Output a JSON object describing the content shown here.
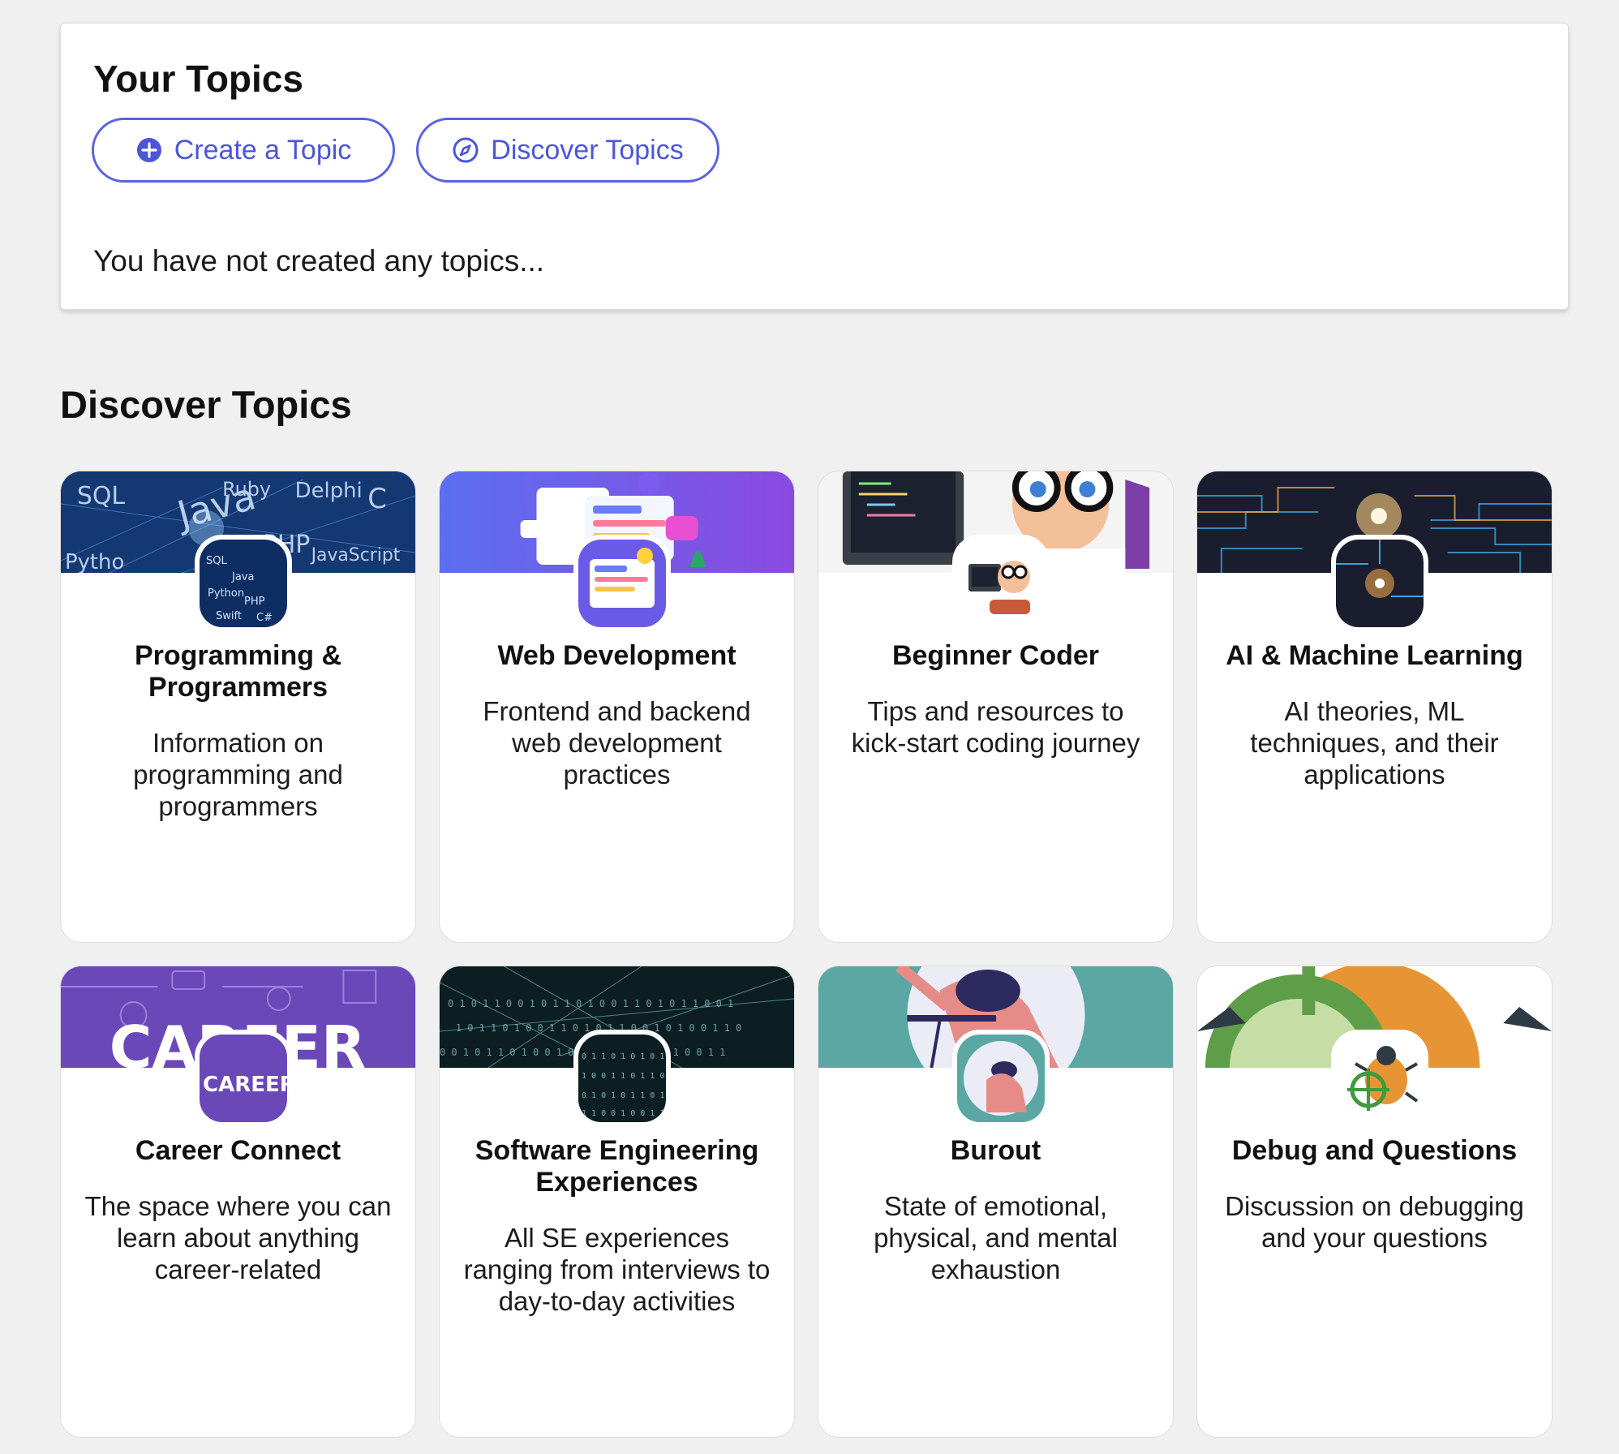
{
  "your_topics": {
    "title": "Your Topics",
    "create_label": "Create a Topic",
    "discover_label": "Discover Topics",
    "empty_message": "You have not created any topics..."
  },
  "discover": {
    "title": "Discover Topics",
    "topics": [
      {
        "title": "Programming & Programmers",
        "description": "Information on programming and programmers",
        "banner_color": "#0d2a5c",
        "image": "code-languages-image"
      },
      {
        "title": "Web Development",
        "description": "Frontend and backend web development practices",
        "banner_color": "#6a5ae6",
        "image": "web-ui-illustration"
      },
      {
        "title": "Beginner Coder",
        "description": "Tips and resources to kick-start coding journey",
        "banner_color": "#f4f4f4",
        "image": "baby-coder-illustration"
      },
      {
        "title": "AI & Machine Learning",
        "description": "AI theories, ML techniques, and their applications",
        "banner_color": "#1a1d2e",
        "image": "circuit-board-image"
      },
      {
        "title": "Career Connect",
        "description": "The space where you can learn about anything career-related",
        "banner_color": "#6a48b8",
        "image": "career-illustration"
      },
      {
        "title": "Software Engineering Experiences",
        "description": "All SE experiences ranging from interviews to day-to-day activities",
        "banner_color": "#0c1e22",
        "image": "data-network-image"
      },
      {
        "title": "Burout",
        "description": "State of emotional, physical, and mental exhaustion",
        "banner_color": "#5aa7a3",
        "image": "burnout-illustration"
      },
      {
        "title": "Debug and Questions",
        "description": "Discussion on debugging and your questions",
        "banner_color": "#e79534",
        "image": "bug-target-icon"
      }
    ]
  }
}
